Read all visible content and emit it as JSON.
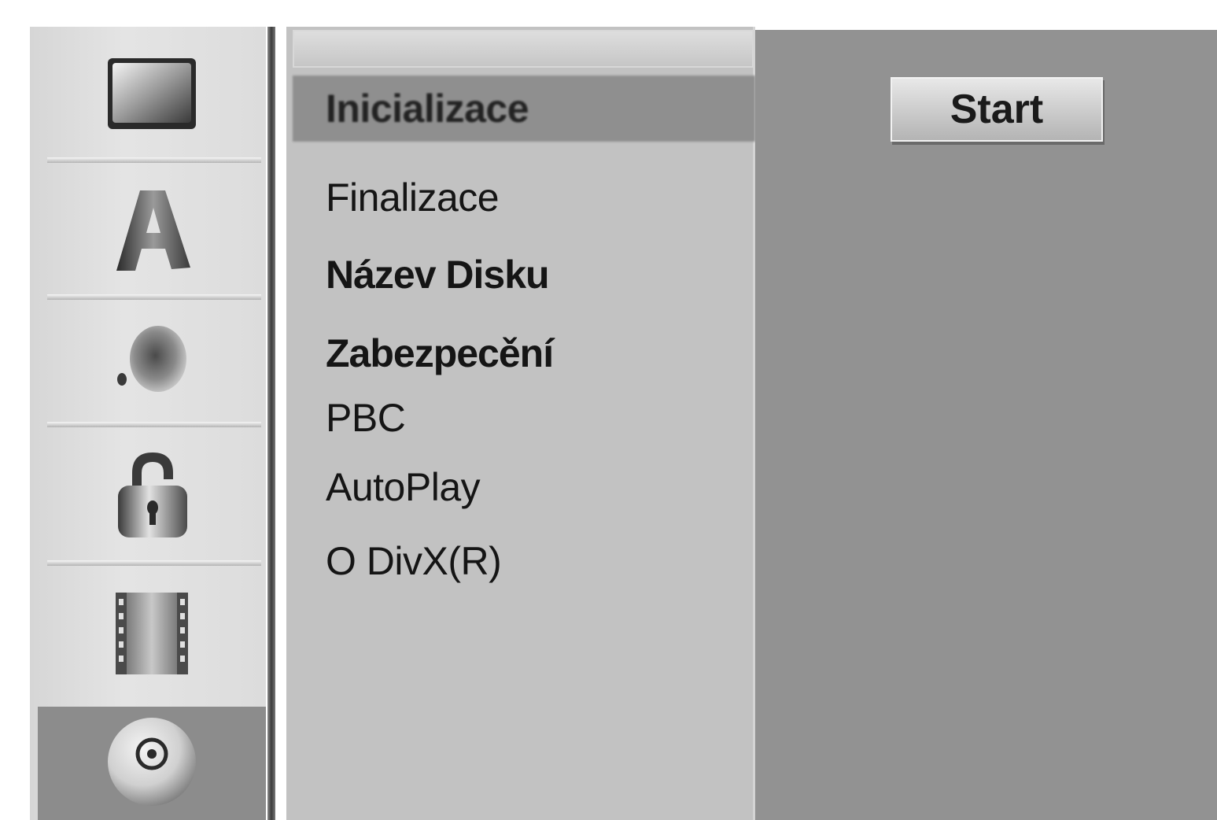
{
  "sidebar": {
    "items": [
      {
        "icon": "tv-icon"
      },
      {
        "icon": "language-icon"
      },
      {
        "icon": "audio-icon"
      },
      {
        "icon": "lock-icon"
      },
      {
        "icon": "film-icon"
      },
      {
        "icon": "disc-icon",
        "selected": true
      }
    ]
  },
  "menu": {
    "items": [
      {
        "label": "Inicializace",
        "highlighted": true
      },
      {
        "label": "Finalizace"
      },
      {
        "label": "Název Disku"
      },
      {
        "label": "Zabezpecění"
      },
      {
        "label": "PBC"
      },
      {
        "label": "AutoPlay"
      },
      {
        "label": "O DivX(R)"
      }
    ]
  },
  "content": {
    "start_label": "Start"
  },
  "colors": {
    "sidebar_bg": "#dcdcdc",
    "list_bg": "#c2c2c2",
    "highlight_bg": "#8f8f8f",
    "content_bg": "#929292"
  }
}
